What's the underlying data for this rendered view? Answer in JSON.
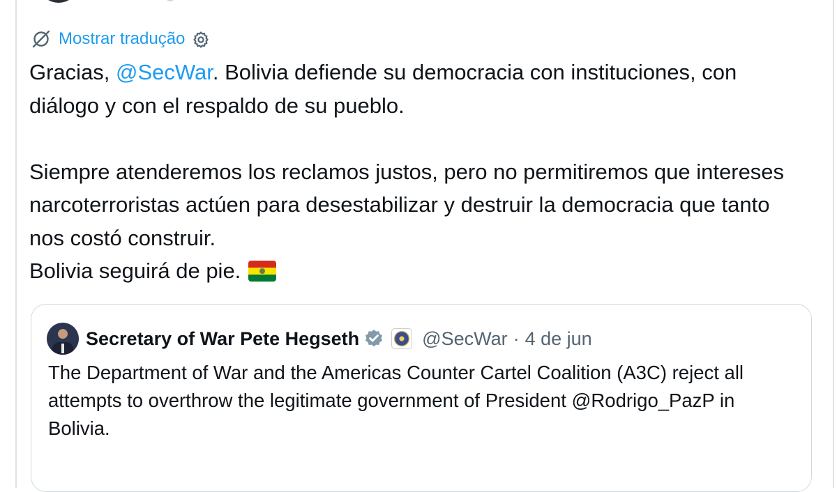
{
  "translate": {
    "label": "Mostrar tradução"
  },
  "tweet": {
    "p1_before": "Gracias, ",
    "p1_mention": "@SecWar",
    "p1_after": ". Bolivia defiende su democracia con instituciones, con diálogo y con el respaldo de su pueblo.",
    "p2": "Siempre atenderemos los reclamos justos, pero no permitiremos que intereses narcoterroristas actúen para desestabilizar y destruir la democracia que tanto nos costó construir.",
    "p3": "Bolivia seguirá de pie. ",
    "flag_colors": [
      "#d52b1e",
      "#f9e300",
      "#007934"
    ]
  },
  "quote": {
    "author_name": "Secretary of War Pete Hegseth",
    "handle": "@SecWar",
    "separator": "·",
    "date": "4 de jun",
    "text": "The Department of War and the Americas Counter Cartel Coalition (A3C) reject all attempts to overthrow the legitimate government of President @Rodrigo_PazP in Bolivia."
  },
  "icons": {
    "translate": "globe-slash-icon",
    "settings": "gear-icon",
    "verified": "verified-badge-icon",
    "affiliate": "department-seal-icon"
  },
  "colors": {
    "accent": "#1d9bf0",
    "text": "#0f1419",
    "secondary": "#536471",
    "border": "#cfd9de",
    "verified_gray": "#829aab"
  }
}
